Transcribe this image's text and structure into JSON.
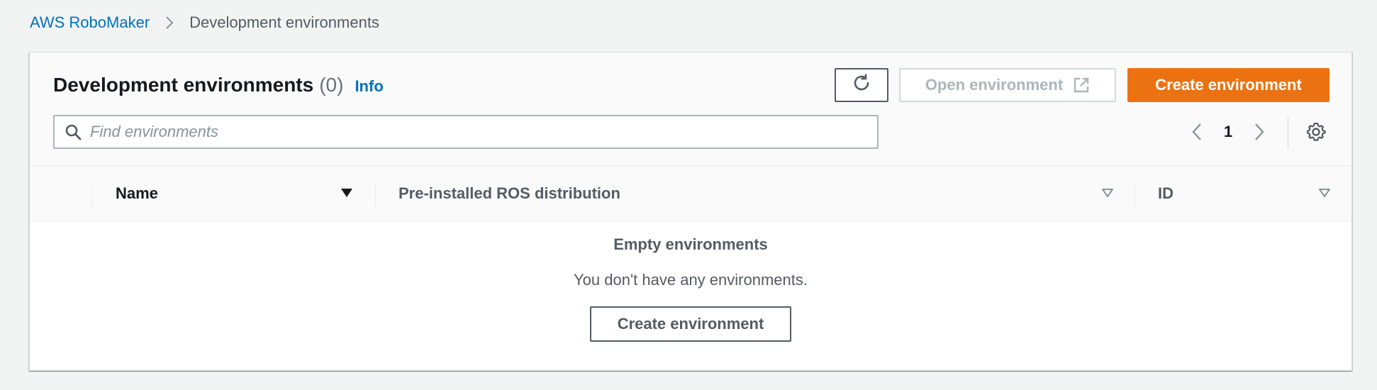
{
  "breadcrumb": {
    "root": "AWS RoboMaker",
    "current": "Development environments"
  },
  "header": {
    "title": "Development environments",
    "count": "(0)",
    "info": "Info"
  },
  "toolbar": {
    "refresh_icon": "refresh-icon",
    "open_label": "Open environment",
    "open_icon": "external-link-icon",
    "create_label": "Create environment"
  },
  "search": {
    "placeholder": "Find environments",
    "value": ""
  },
  "pagination": {
    "current_page": "1"
  },
  "table": {
    "columns": [
      {
        "label": "Name",
        "sort": "descending-active"
      },
      {
        "label": "Pre-installed ROS distribution",
        "sort": "inactive"
      },
      {
        "label": "ID",
        "sort": "inactive"
      }
    ]
  },
  "empty_state": {
    "title": "Empty environments",
    "description": "You don't have any environments.",
    "button_label": "Create environment"
  },
  "colors": {
    "accent": "#ec7211",
    "link": "#0073bb",
    "background": "#f2f3f3",
    "text": "#16191f",
    "muted": "#545b64"
  }
}
